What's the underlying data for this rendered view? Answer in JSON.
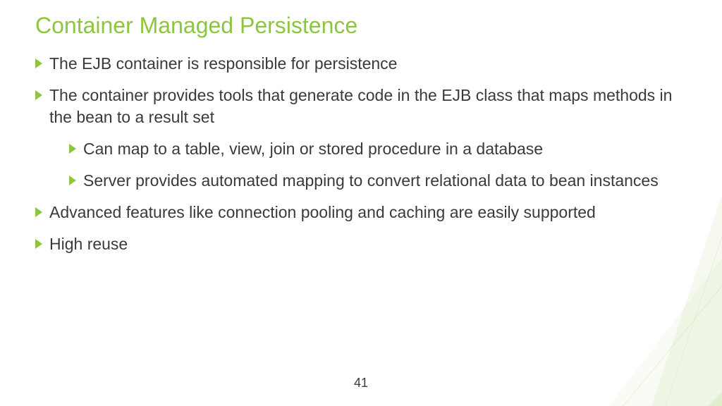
{
  "slide": {
    "title": "Container Managed Persistence",
    "bullets": [
      {
        "level": 0,
        "text": "The EJB container is responsible for persistence"
      },
      {
        "level": 0,
        "text": "The container provides tools that generate code in the EJB class that maps methods in the bean to a result set"
      },
      {
        "level": 1,
        "text": "Can map to a table, view, join or stored procedure in a database"
      },
      {
        "level": 1,
        "text": "Server provides automated mapping to convert relational data to bean instances"
      },
      {
        "level": 0,
        "text": "Advanced features like connection pooling and caching are easily supported"
      },
      {
        "level": 0,
        "text": "High reuse"
      }
    ],
    "page_number": "41"
  }
}
